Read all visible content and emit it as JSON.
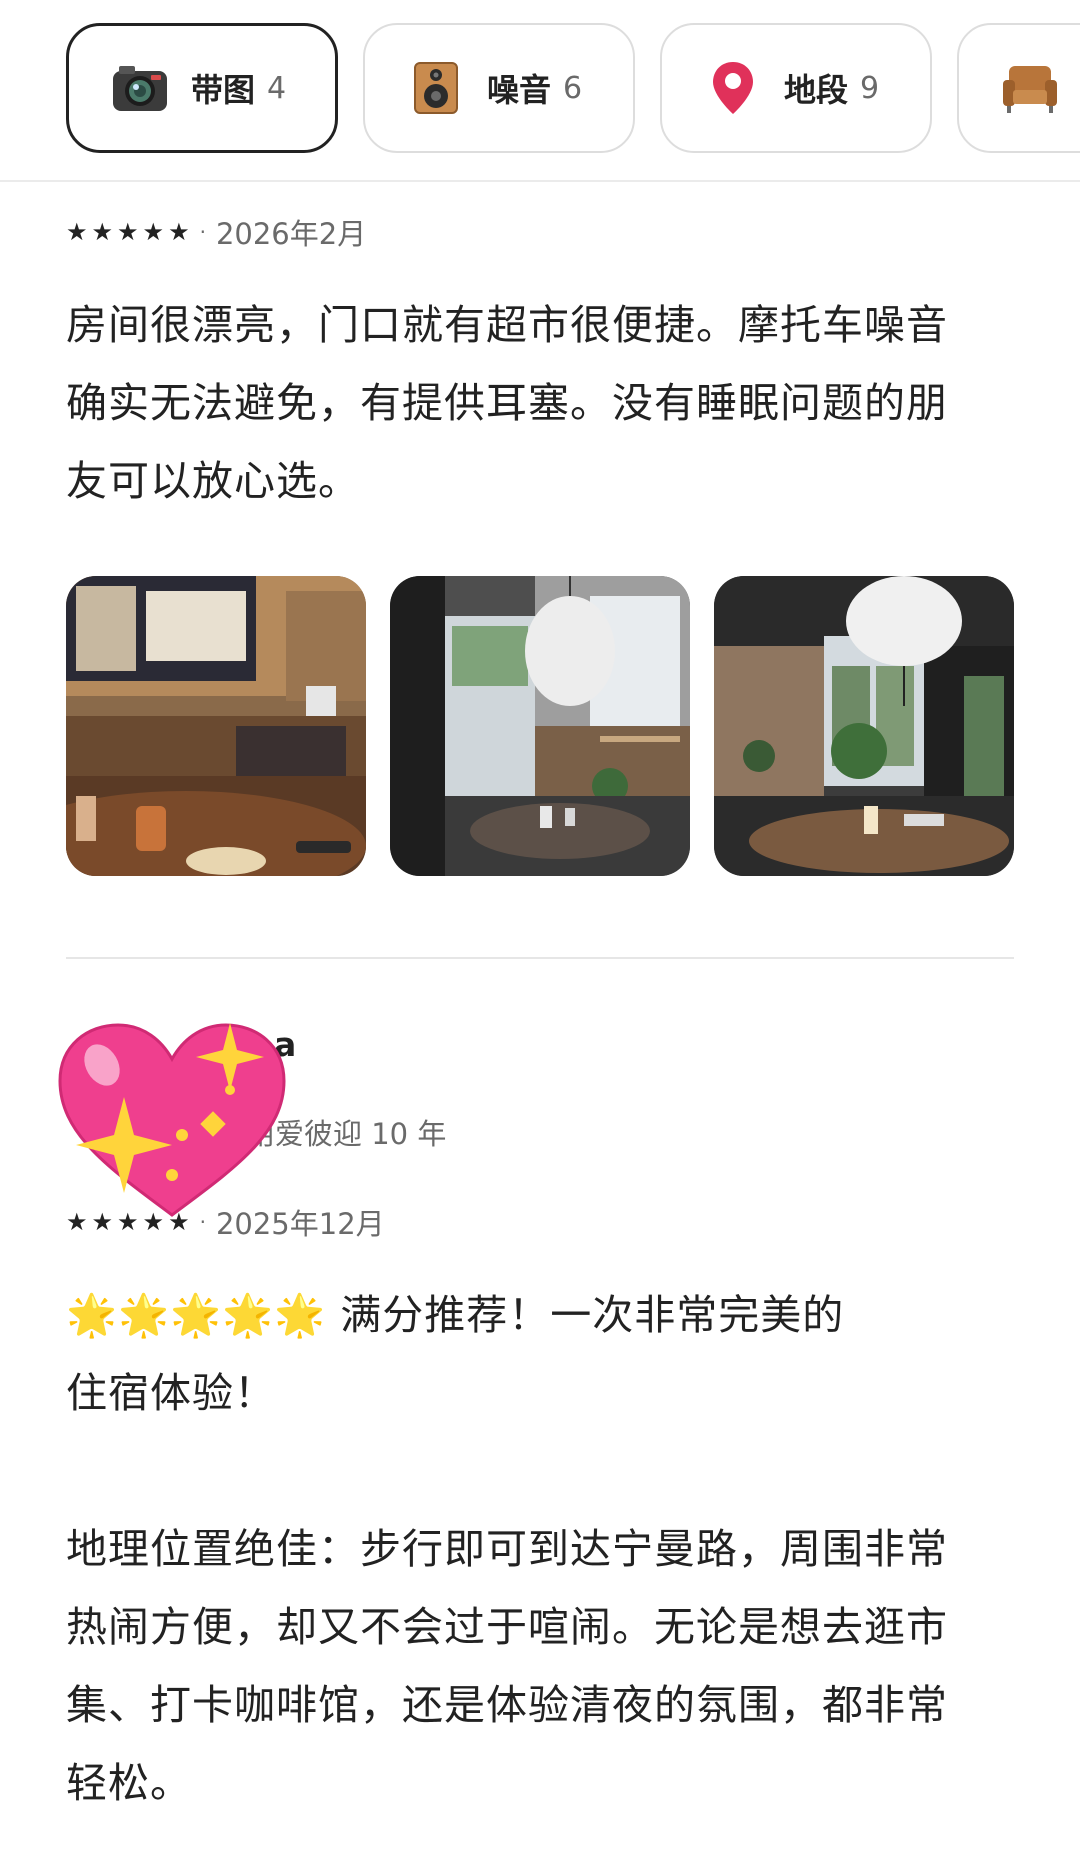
{
  "filters": [
    {
      "icon": "camera-icon",
      "label": "带图",
      "count": "4",
      "selected": true
    },
    {
      "icon": "speaker-icon",
      "label": "噪音",
      "count": "6",
      "selected": false
    },
    {
      "icon": "location-pin-icon",
      "label": "地段",
      "count": "9",
      "selected": false
    },
    {
      "icon": "armchair-icon",
      "label": "",
      "count": "",
      "selected": false
    }
  ],
  "review1": {
    "stars": "★★★★★",
    "separator": "·",
    "date": "2026年2月",
    "text": "房间很漂亮，门口就有超市很便捷。摩托车噪音\n确实无法避免，有提供耳塞。没有睡眠问题的朋\n友可以放心选。",
    "photos": [
      "living-room-tv",
      "dining-area-lamp",
      "lounge-plants"
    ]
  },
  "review2": {
    "reviewer_name": "a",
    "reviewer_sub": "用爱彼迎 10 年",
    "stars": "★★★★★",
    "separator": "·",
    "date": "2025年12月",
    "text": "🌟🌟🌟🌟🌟 满分推荐！一次非常完美的\n住宿体验！\n\n地理位置绝佳：步行即可到达宁曼路，周围非常\n热闹方便，却又不会过于喧闹。无论是想去逛市\n集、打卡咖啡馆，还是体验清夜的氛围，都非常\n轻松。"
  },
  "colors": {
    "text": "#222222",
    "muted": "#6a6a6a",
    "pin": "#e0315a",
    "heart": "#ef3f8e",
    "sparkle": "#ffd43b"
  }
}
